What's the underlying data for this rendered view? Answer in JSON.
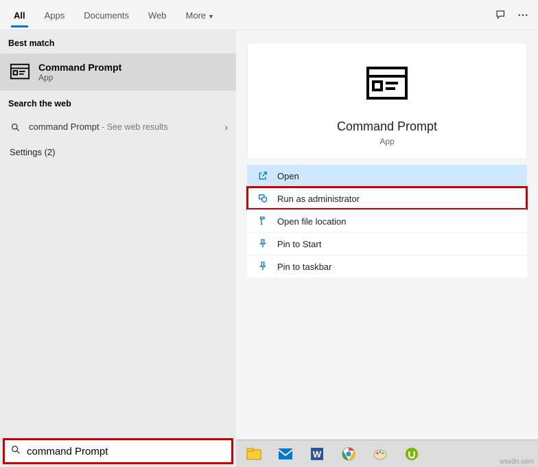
{
  "tabs": {
    "all": "All",
    "apps": "Apps",
    "documents": "Documents",
    "web": "Web",
    "more": "More"
  },
  "left": {
    "best_match": "Best match",
    "result": {
      "title": "Command Prompt",
      "sub": "App"
    },
    "search_web": "Search the web",
    "web_query": "command Prompt",
    "web_hint": " - See web results",
    "settings": "Settings (2)"
  },
  "right": {
    "title": "Command Prompt",
    "sub": "App",
    "actions": {
      "open": "Open",
      "run_admin": "Run as administrator",
      "open_loc": "Open file location",
      "pin_start": "Pin to Start",
      "pin_taskbar": "Pin to taskbar"
    }
  },
  "search": {
    "value": "command Prompt"
  },
  "watermark": "wsxdn.com"
}
